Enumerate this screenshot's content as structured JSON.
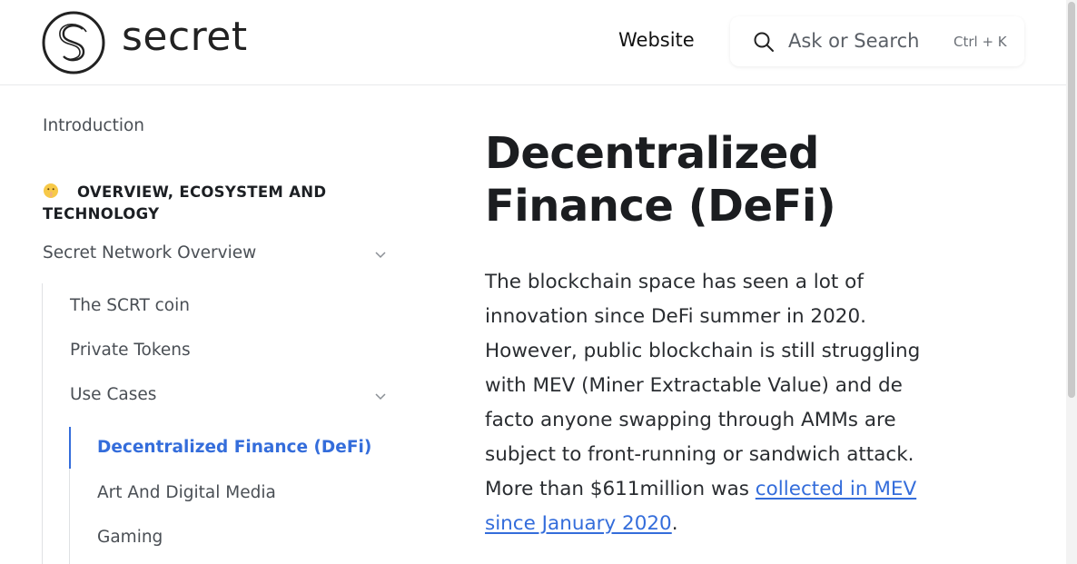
{
  "header": {
    "logo_text": "secret",
    "nav_website": "Website",
    "search_placeholder": "Ask or Search",
    "search_shortcut": "Ctrl + K"
  },
  "sidebar": {
    "introduction": "Introduction",
    "section_title": "OVERVIEW, ECOSYSTEM AND TECHNOLOGY",
    "overview": "Secret Network Overview",
    "scrt_coin": "The SCRT coin",
    "private_tokens": "Private Tokens",
    "use_cases": "Use Cases",
    "defi": "Decentralized Finance (DeFi)",
    "art": "Art And Digital Media",
    "gaming": "Gaming"
  },
  "main": {
    "title": "Decentralized Finance (DeFi)",
    "paragraph_text": "The blockchain space has seen a lot of innovation since DeFi summer in 2020. However, public blockchain is still struggling with MEV (Miner Extractable Value) and de facto anyone swapping through AMMs are subject to front-running or sandwich attack. More than $611million was ",
    "paragraph_link": "collected in MEV since January 2020",
    "paragraph_end": "."
  },
  "colors": {
    "accent": "#346ddb"
  }
}
